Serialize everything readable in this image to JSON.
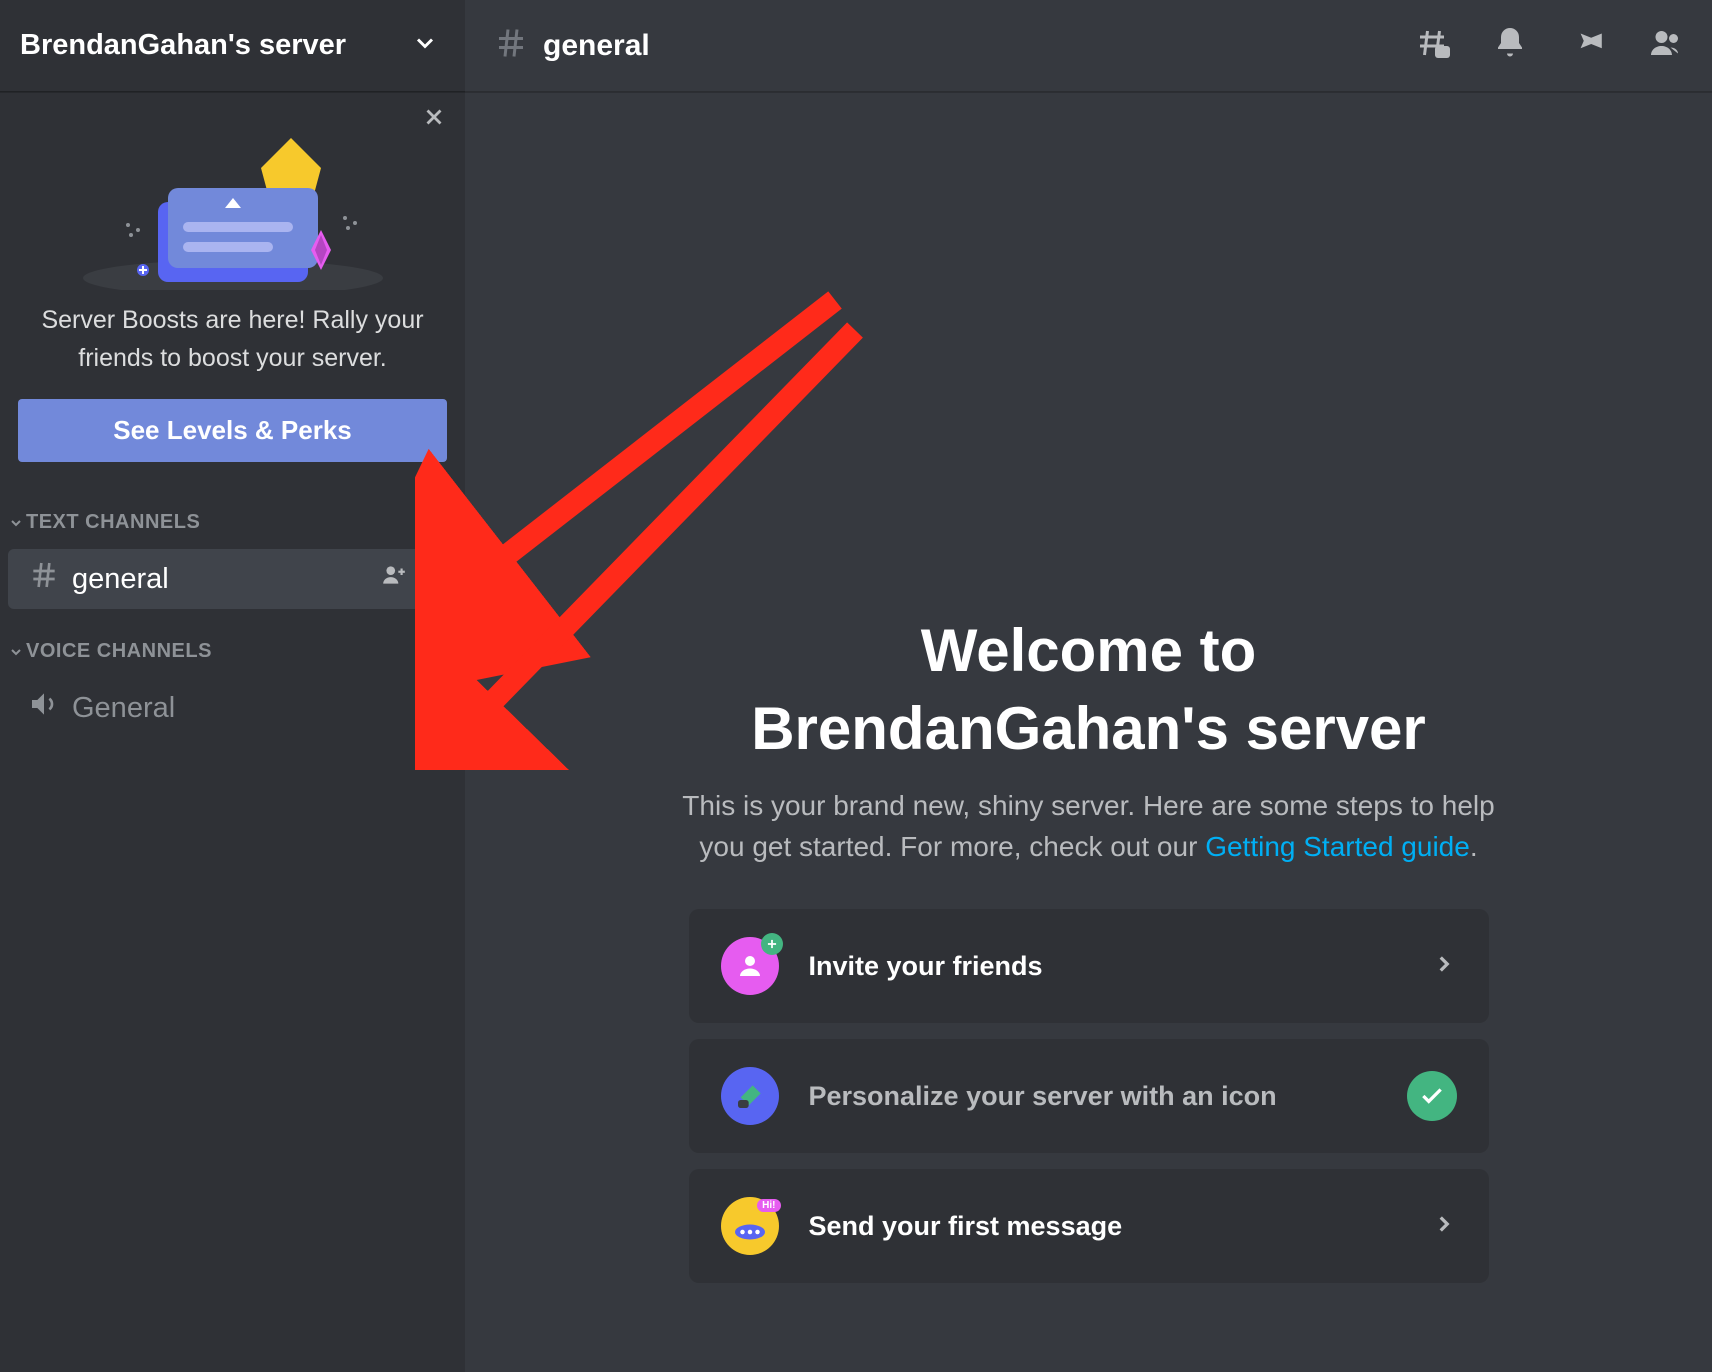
{
  "server": {
    "name": "BrendanGahan's server"
  },
  "boost": {
    "text": "Server Boosts are here! Rally your friends to boost your server.",
    "button": "See Levels & Perks"
  },
  "sections": {
    "text": {
      "title": "TEXT CHANNELS"
    },
    "voice": {
      "title": "VOICE CHANNELS"
    }
  },
  "channels": {
    "text_general": "general",
    "voice_general": "General"
  },
  "header": {
    "channel": "general"
  },
  "welcome": {
    "title_line1": "Welcome to",
    "title_line2": "BrendanGahan's server",
    "sub_pre": "This is your brand new, shiny server. Here are some steps to help you get started. For more, check out our ",
    "link": "Getting Started guide",
    "sub_post": "."
  },
  "cards": {
    "invite": "Invite your friends",
    "personalize": "Personalize your server with an icon",
    "first_message": "Send your first message"
  }
}
